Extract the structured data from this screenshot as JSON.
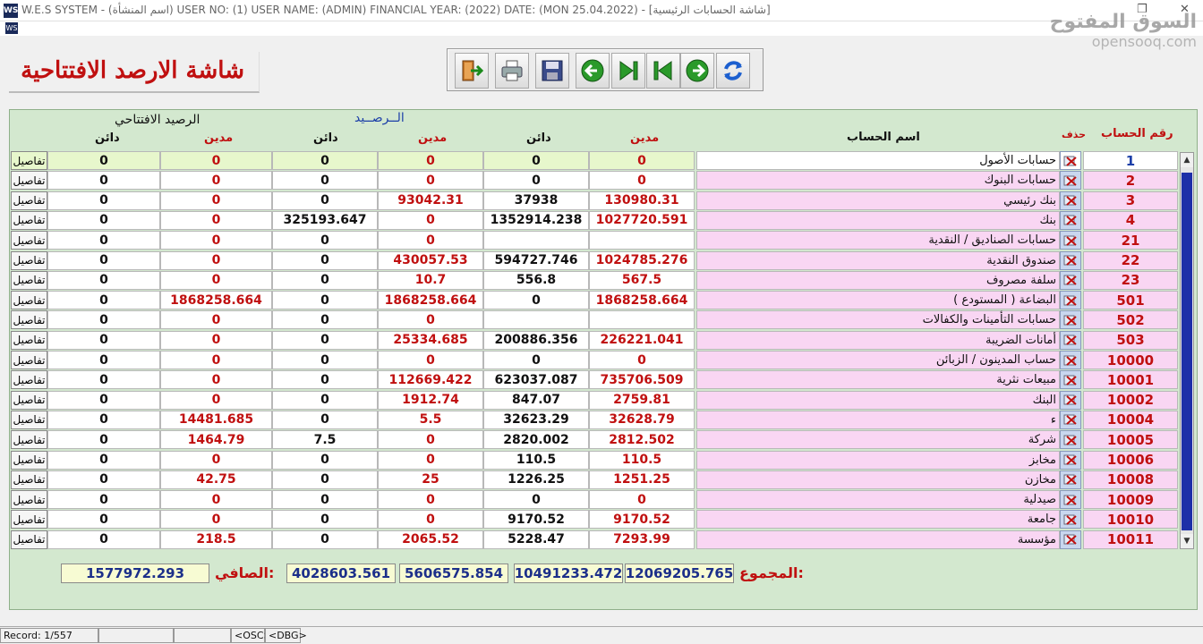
{
  "window": {
    "app_icon": "WS",
    "title": "W.E.S SYSTEM -  (اسم المنشأة)  USER NO: (1) USER NAME: (ADMIN) FINANCIAL YEAR: (2022)  DATE: (MON 25.04.2022) - [شاشة الحسابات الرئيسية]",
    "restore_glyph": "❐",
    "close_glyph": "✕"
  },
  "watermark": {
    "arabic": "السوق المفتوح",
    "latin": "opensooq.com"
  },
  "page_title": "شاشة الارصد الافتتاحية",
  "toolbar": {
    "buttons": [
      "exit-icon",
      "print-icon",
      "save-icon",
      "back-arrow-icon",
      "last-record-icon",
      "first-record-icon",
      "forward-arrow-icon",
      "refresh-icon"
    ]
  },
  "headers": {
    "account_no": "رقم الحساب",
    "delete": "حذف",
    "account_name": "اسم الحساب",
    "balance_group": "الــرصــيد",
    "opening_group": "الرصيد الافتتاحي",
    "debit": "مدين",
    "credit": "دائن"
  },
  "details_label": "تفاصيل",
  "rows": [
    {
      "acc": "1",
      "name": "حسابات الأصول",
      "bal_debit": "0",
      "bal_credit": "0",
      "b_debit": "0",
      "b_credit": "0",
      "o_debit": "0",
      "o_credit": "0"
    },
    {
      "acc": "2",
      "name": "حسابات البنوك",
      "bal_debit": "0",
      "bal_credit": "0",
      "b_debit": "0",
      "b_credit": "0",
      "o_debit": "0",
      "o_credit": "0"
    },
    {
      "acc": "3",
      "name": "بنك رئيسي",
      "bal_debit": "130980.31",
      "bal_credit": "37938",
      "b_debit": "93042.31",
      "b_credit": "0",
      "o_debit": "0",
      "o_credit": "0"
    },
    {
      "acc": "4",
      "name": "بنك",
      "bal_debit": "1027720.591",
      "bal_credit": "1352914.238",
      "b_debit": "0",
      "b_credit": "325193.647",
      "o_debit": "0",
      "o_credit": "0"
    },
    {
      "acc": "21",
      "name": "حسابات الصناديق / النقدية",
      "bal_debit": "",
      "bal_credit": "",
      "b_debit": "0",
      "b_credit": "0",
      "o_debit": "0",
      "o_credit": "0"
    },
    {
      "acc": "22",
      "name": "صندوق النقدية",
      "bal_debit": "1024785.276",
      "bal_credit": "594727.746",
      "b_debit": "430057.53",
      "b_credit": "0",
      "o_debit": "0",
      "o_credit": "0"
    },
    {
      "acc": "23",
      "name": "سلفة مصروف",
      "bal_debit": "567.5",
      "bal_credit": "556.8",
      "b_debit": "10.7",
      "b_credit": "0",
      "o_debit": "0",
      "o_credit": "0"
    },
    {
      "acc": "501",
      "name": "البضاعة ( المستودع )",
      "bal_debit": "1868258.664",
      "bal_credit": "0",
      "b_debit": "1868258.664",
      "b_credit": "0",
      "o_debit": "1868258.664",
      "o_credit": "0"
    },
    {
      "acc": "502",
      "name": "حسابات التأمينات والكفالات",
      "bal_debit": "",
      "bal_credit": "",
      "b_debit": "0",
      "b_credit": "0",
      "o_debit": "0",
      "o_credit": "0"
    },
    {
      "acc": "503",
      "name": "أمانات الضريبة",
      "bal_debit": "226221.041",
      "bal_credit": "200886.356",
      "b_debit": "25334.685",
      "b_credit": "0",
      "o_debit": "0",
      "o_credit": "0"
    },
    {
      "acc": "10000",
      "name": "حساب المدينون / الزبائن",
      "bal_debit": "0",
      "bal_credit": "0",
      "b_debit": "0",
      "b_credit": "0",
      "o_debit": "0",
      "o_credit": "0"
    },
    {
      "acc": "10001",
      "name": "مبيعات نثرية",
      "bal_debit": "735706.509",
      "bal_credit": "623037.087",
      "b_debit": "112669.422",
      "b_credit": "0",
      "o_debit": "0",
      "o_credit": "0"
    },
    {
      "acc": "10002",
      "name": "البنك",
      "bal_debit": "2759.81",
      "bal_credit": "847.07",
      "b_debit": "1912.74",
      "b_credit": "0",
      "o_debit": "0",
      "o_credit": "0"
    },
    {
      "acc": "10004",
      "name": "ء",
      "bal_debit": "32628.79",
      "bal_credit": "32623.29",
      "b_debit": "5.5",
      "b_credit": "0",
      "o_debit": "14481.685",
      "o_credit": "0"
    },
    {
      "acc": "10005",
      "name": "شركة",
      "bal_debit": "2812.502",
      "bal_credit": "2820.002",
      "b_debit": "0",
      "b_credit": "7.5",
      "o_debit": "1464.79",
      "o_credit": "0"
    },
    {
      "acc": "10006",
      "name": "مخابز",
      "bal_debit": "110.5",
      "bal_credit": "110.5",
      "b_debit": "0",
      "b_credit": "0",
      "o_debit": "0",
      "o_credit": "0"
    },
    {
      "acc": "10008",
      "name": "مخازن",
      "bal_debit": "1251.25",
      "bal_credit": "1226.25",
      "b_debit": "25",
      "b_credit": "0",
      "o_debit": "42.75",
      "o_credit": "0"
    },
    {
      "acc": "10009",
      "name": "صيدلية",
      "bal_debit": "0",
      "bal_credit": "0",
      "b_debit": "0",
      "b_credit": "0",
      "o_debit": "0",
      "o_credit": "0"
    },
    {
      "acc": "10010",
      "name": "جامعة",
      "bal_debit": "9170.52",
      "bal_credit": "9170.52",
      "b_debit": "0",
      "b_credit": "0",
      "o_debit": "0",
      "o_credit": "0"
    },
    {
      "acc": "10011",
      "name": "مؤسسة",
      "bal_debit": "7293.99",
      "bal_credit": "5228.47",
      "b_debit": "2065.52",
      "b_credit": "0",
      "o_debit": "218.5",
      "o_credit": "0"
    }
  ],
  "totals": {
    "total_label": "المجموع:",
    "net_label": "الصافي:",
    "total_debit": "12069205.765",
    "total_credit": "10491233.472",
    "b_debit": "5606575.854",
    "b_credit": "4028603.561",
    "net": "1577972.293"
  },
  "status": {
    "record": "Record: 1/557",
    "osc": "<OSC>",
    "dbg": "<DBG>"
  },
  "colors": {
    "accent_red": "#c01010",
    "panel_green": "#d3e8cf",
    "name_pink": "#f9d6f3",
    "blue": "#1c3fa8"
  }
}
